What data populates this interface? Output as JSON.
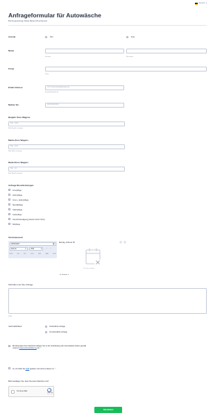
{
  "language": {
    "label": "Deutsch"
  },
  "header": {
    "title": "Anfrageformular für Autowäsche",
    "subtitle": "Buchungsanfrage Filiale Baden/Ulmerbauwet"
  },
  "anrede": {
    "label": "Anrede",
    "options": [
      "Herr",
      "Frau"
    ]
  },
  "name": {
    "label": "Name",
    "first_sub": "Vorname",
    "last_sub": "Nachname"
  },
  "firma": {
    "label": "Firma",
    "sub": "Firma"
  },
  "email": {
    "label": "Email Adresse",
    "placeholder": "z.B. mustermann@beispiel.de",
    "sub": "beispiel@beispiel.de"
  },
  "mobil": {
    "label": "Mobile Tel.",
    "placeholder": "(000) 000-0000"
  },
  "baujahr": {
    "label": "Baujahr Ihres Wagens",
    "placeholder": "Bsp.: 2020",
    "sub": "Bitte Baujahr eintragen"
  },
  "marke": {
    "label": "Marke Ihres Wagens",
    "placeholder": "Bsp.: Audi",
    "sub": "Bitte Marke eintragen"
  },
  "modell": {
    "label": "Model Ihres Wagens",
    "placeholder": "Bsp.: A4",
    "sub": "Bitte Modell eintragen"
  },
  "services": {
    "label": "Anfrage Dienstleistungen",
    "options": [
      "Innenpflege",
      "Außenpflege",
      "Innen + Außenpflege",
      "Spezialpflege",
      "Cabriopflege",
      "Lederpflege",
      "Geruchsbeseitigung (intensiv durch Ozon)",
      "Sitzpflege"
    ]
  },
  "termin": {
    "label": "Terminwunsch",
    "date_value": "09/02/2024",
    "month": "Februar",
    "year": "2024",
    "weekdays": [
      "MON",
      "DIE",
      "MIT",
      "DON",
      "FRE",
      "SAM",
      "SON"
    ],
    "selected_day": "Montag, Februar 05",
    "no_slots": "Kein Slot verfügbar",
    "timezone": "Zeitzone",
    "prev": "‹",
    "next": "›"
  },
  "anliegen": {
    "label": "Schreiben sie Ihre Anfrage",
    "counter": "0/180"
  },
  "verbindlich": {
    "label": "Verbindlichkeit",
    "options": [
      "Verbindliche Anfrage",
      "Unverbindliche Anfrage"
    ]
  },
  "consent": {
    "text_before": "Mit Absenden Ihrer Nachricht willigen Sie in die Verarbeitung der übermittelten Daten gemäß unserer ",
    "link": "Datenschutzerklärung",
    "text_after": " ein. *"
  },
  "agb": {
    "text_before": "Ja, ich habe die ",
    "link": "AGB",
    "text_after": " gelesen und stimme diesen zu.",
    "required": "*"
  },
  "captcha": {
    "label": "Bitte bestätigen Sie, dass Sie keine Maschine sind",
    "checkbox_label": "I'm not a robot",
    "brand": "reCAPTCHA",
    "links": "Privacy - Terms"
  },
  "submit": {
    "label": "Abschicken"
  }
}
